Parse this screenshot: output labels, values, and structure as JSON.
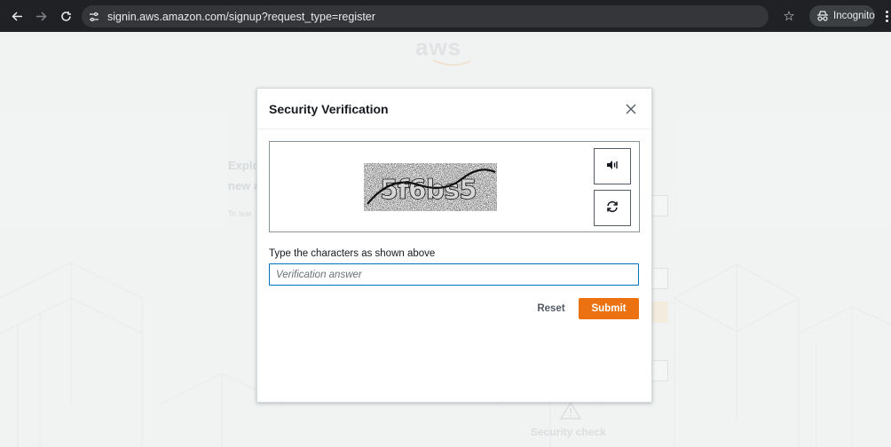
{
  "browser": {
    "url": "signin.aws.amazon.com/signup?request_type=register",
    "profile_label": "Incognito"
  },
  "background": {
    "logo_text": "aws",
    "heading_line1": "Explo",
    "heading_line2": "new a",
    "subtext": "To lear",
    "security_check_label": "Security check"
  },
  "modal": {
    "title": "Security Verification",
    "captcha_text": "5f6bs5",
    "answer_label": "Type the characters as shown above",
    "answer_value": "",
    "answer_placeholder": "Verification answer",
    "reset_label": "Reset",
    "submit_label": "Submit"
  },
  "colors": {
    "accent": "#ec7211",
    "input_focus": "#0073bb",
    "chrome_bg": "#202124"
  },
  "icons": {
    "back": "back-arrow-icon",
    "forward": "forward-arrow-icon",
    "reload": "reload-icon",
    "site_info": "site-info-icon",
    "bookmark": "star-icon",
    "incognito": "incognito-icon",
    "menu": "more-vert-icon",
    "close": "close-icon",
    "audio": "audio-icon",
    "refresh": "refresh-icon"
  }
}
